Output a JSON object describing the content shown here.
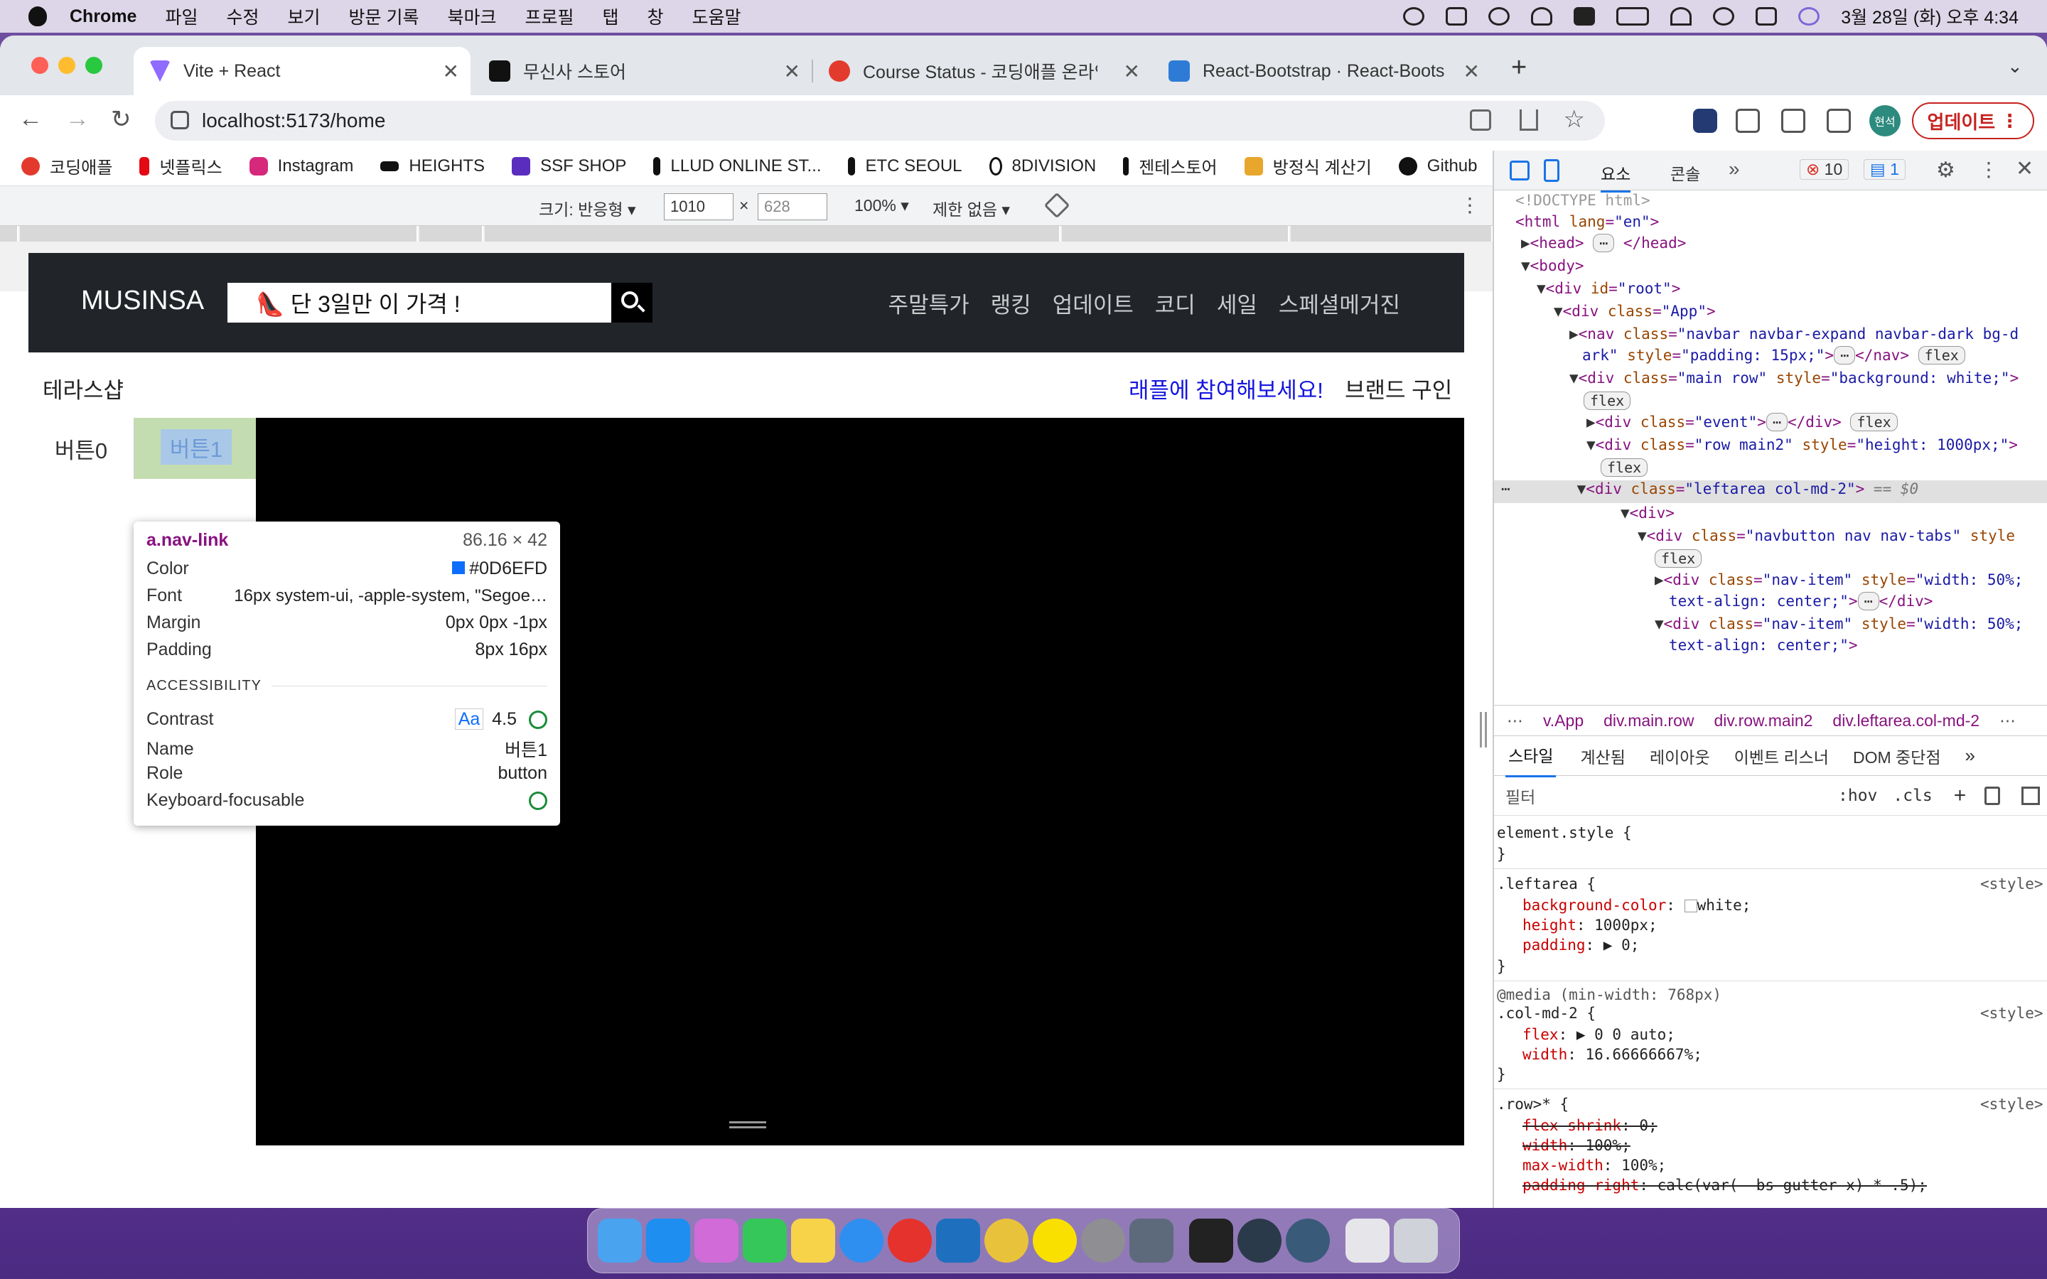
{
  "menubar": {
    "app": "Chrome",
    "items": [
      "파일",
      "수정",
      "보기",
      "방문 기록",
      "북마크",
      "프로필",
      "탭",
      "창",
      "도움말"
    ],
    "datetime": "3월 28일 (화) 오후 4:34"
  },
  "tabs": [
    {
      "title": "Vite + React",
      "fav_color": "#8f6bff"
    },
    {
      "title": "무신사 스토어",
      "fav_color": "#111111"
    },
    {
      "title": "Course Status - 코딩애플 온라인 강",
      "fav_color": "#e23b2e"
    },
    {
      "title": "React-Bootstrap · React-Boots",
      "fav_color": "#2e7bd6"
    }
  ],
  "omnibox": {
    "url": "localhost:5173/home"
  },
  "profile": {
    "name": "현석"
  },
  "update_label": "업데이트",
  "bookmarks": [
    "코딩애플",
    "넷플릭스",
    "Instagram",
    "HEIGHTS",
    "SSF SHOP",
    "LLUD ONLINE ST...",
    "ETC SEOUL",
    "8DIVISION",
    "젠테스토어",
    "방정식 계산기",
    "Github"
  ],
  "device_toolbar": {
    "size_label": "크기: 반응형 ▾",
    "width": "1010",
    "times": "×",
    "height": "628",
    "zoom": "100% ▾",
    "throttle": "제한 없음 ▾"
  },
  "page": {
    "brand": "MUSINSA",
    "search_value": "👠 단 3일만 이 가격 !",
    "nav": [
      "주말특가",
      "랭킹",
      "업데이트",
      "코디",
      "세일",
      "스페셜메거진"
    ],
    "shop_title": "테라스샵",
    "raffle": "래플에 참여해보세요!",
    "brand_recruit": "브랜드 구인",
    "tab0": "버튼0",
    "tab1": "버튼1"
  },
  "tooltip": {
    "selector": "a.nav-link",
    "dims": "86.16 × 42",
    "color_label": "Color",
    "color_value": "#0D6EFD",
    "font_label": "Font",
    "font_value": "16px system-ui, -apple-system, \"Segoe…",
    "margin_label": "Margin",
    "margin_value": "0px 0px -1px",
    "padding_label": "Padding",
    "padding_value": "8px 16px",
    "a11y_heading": "ACCESSIBILITY",
    "contrast_label": "Contrast",
    "contrast_aa": "Aa",
    "contrast_value": "4.5",
    "name_label": "Name",
    "name_value": "버튼1",
    "role_label": "Role",
    "role_value": "button",
    "focus_label": "Keyboard-focusable"
  },
  "devtools": {
    "tabs": [
      "요소",
      "콘솔"
    ],
    "errors": "10",
    "messages": "1",
    "breadcrumbs": [
      "v.App",
      "div.main.row",
      "div.row.main2",
      "div.leftarea.col-md-2"
    ],
    "style_tabs": [
      "스타일",
      "계산됨",
      "레이아웃",
      "이벤트 리스너",
      "DOM 중단점"
    ],
    "filter_placeholder": "필터",
    "hov": ":hov",
    "cls": ".cls"
  },
  "colors": {
    "navbar_bg": "#212529",
    "accent_link": "#0D6EFD",
    "raffle_link": "#1515e0",
    "tab_highlight": "#c4ddb0"
  }
}
